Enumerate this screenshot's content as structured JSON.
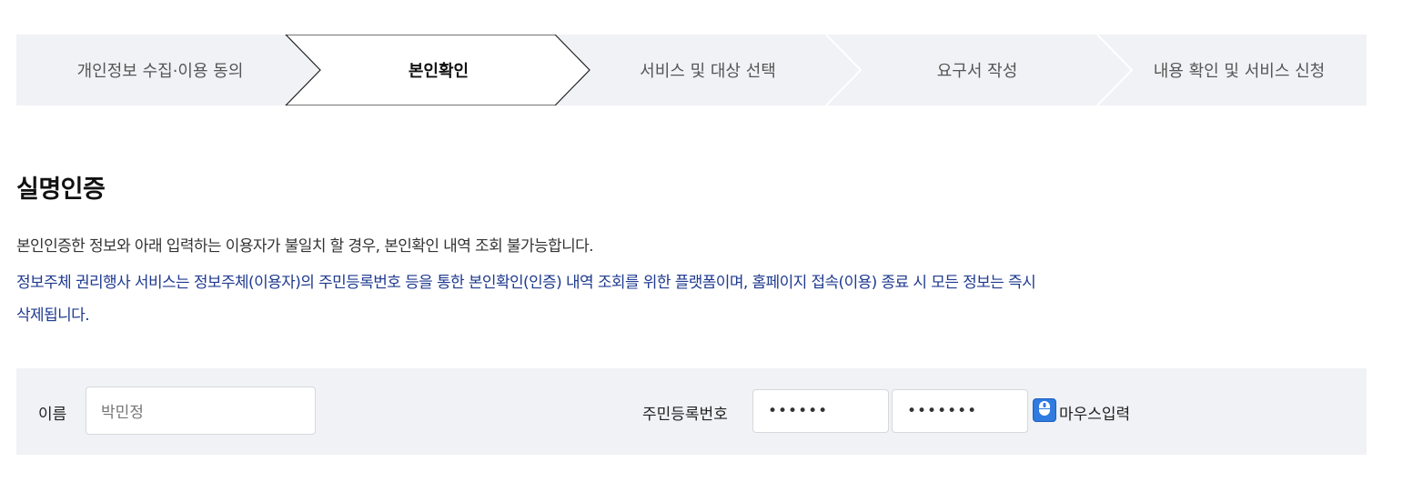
{
  "steps": [
    {
      "label": "개인정보 수집·이용 동의",
      "active": false
    },
    {
      "label": "본인확인",
      "active": true
    },
    {
      "label": "서비스 및 대상 선택",
      "active": false
    },
    {
      "label": "요구서 작성",
      "active": false
    },
    {
      "label": "내용 확인 및 서비스 신청",
      "active": false
    }
  ],
  "section": {
    "title": "실명인증",
    "notice": "본인인증한 정보와 아래 입력하는 이용자가 불일치 할 경우, 본인확인 내역 조회 불가능합니다.",
    "info_line1": "정보주체 권리행사 서비스는 정보주체(이용자)의 주민등록번호 등을 통한 본인확인(인증) 내역 조회를 위한 플랫폼이며, 홈페이지 접속(이용) 종료 시 모든 정보는 즉시",
    "info_line2": "삭제됩니다."
  },
  "form": {
    "name_label": "이름",
    "name_value": "박민정",
    "rrn_label": "주민등록번호",
    "rrn_front": "••••••",
    "rrn_back": "•••••••",
    "mouse_input_label": "마우스입력",
    "mouse_icon": "mouse-icon"
  },
  "colors": {
    "step_bg": "#f1f2f5",
    "info_text": "#1f3a8f",
    "accent": "#2f7be0"
  }
}
